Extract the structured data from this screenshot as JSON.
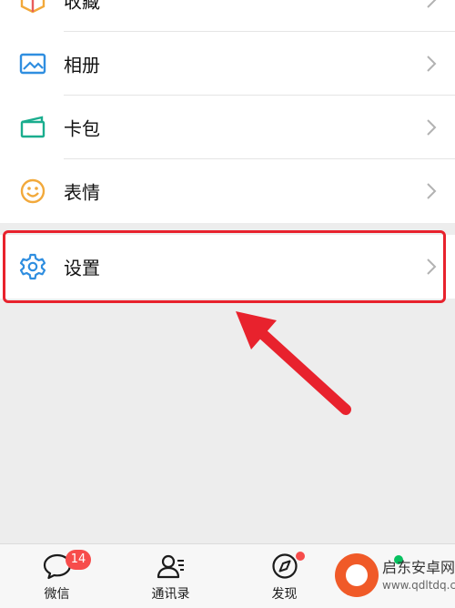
{
  "menu": {
    "items": [
      {
        "label": "收藏",
        "icon": "favorites-cube-icon"
      },
      {
        "label": "相册",
        "icon": "album-image-icon"
      },
      {
        "label": "卡包",
        "icon": "card-wallet-icon"
      },
      {
        "label": "表情",
        "icon": "emoji-face-icon"
      }
    ],
    "settings": {
      "label": "设置",
      "icon": "gear-icon"
    }
  },
  "tabbar": {
    "chats": {
      "label": "微信",
      "badge": "14"
    },
    "contacts": {
      "label": "通讯录"
    },
    "discover": {
      "label": "发现"
    }
  },
  "watermark": {
    "title": "启东安卓网",
    "url": "www.qdltdq.com"
  },
  "colors": {
    "annotation": "#e8222d",
    "badge": "#f74c4b",
    "wechat_green": "#07c160",
    "page_bg": "#ededed"
  }
}
